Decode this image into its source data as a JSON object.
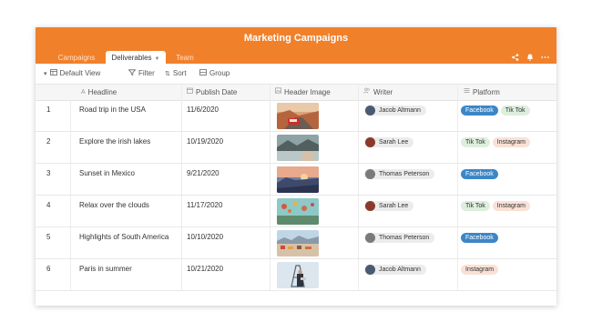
{
  "app": {
    "title": "Marketing Campaigns"
  },
  "tabs": [
    {
      "label": "Campaigns",
      "active": false
    },
    {
      "label": "Deliverables",
      "active": true
    },
    {
      "label": "Team",
      "active": false
    }
  ],
  "top_icons": [
    "share-icon",
    "bell-icon",
    "more-icon"
  ],
  "toolbar": {
    "view_label": "Default View",
    "filter_label": "Filter",
    "sort_label": "Sort",
    "group_label": "Group"
  },
  "columns": [
    {
      "label": "Headline",
      "icon": "text-icon"
    },
    {
      "label": "Publish Date",
      "icon": "calendar-icon"
    },
    {
      "label": "Header Image",
      "icon": "image-icon"
    },
    {
      "label": "Writer",
      "icon": "people-icon"
    },
    {
      "label": "Platform",
      "icon": "list-icon"
    }
  ],
  "rows": [
    {
      "num": "1",
      "headline": "Road trip in the USA",
      "date": "11/6/2020",
      "image": "road-trip-image",
      "writer": "Jacob Altmann",
      "platforms": [
        "Facebook",
        "Tik Tok"
      ]
    },
    {
      "num": "2",
      "headline": "Explore the irish lakes",
      "date": "10/19/2020",
      "image": "irish-lakes-image",
      "writer": "Sarah Lee",
      "platforms": [
        "Tik Tok",
        "Instagram"
      ]
    },
    {
      "num": "3",
      "headline": "Sunset in Mexico",
      "date": "9/21/2020",
      "image": "sunset-mexico-image",
      "writer": "Thomas Peterson",
      "platforms": [
        "Facebook"
      ]
    },
    {
      "num": "4",
      "headline": "Relax over the clouds",
      "date": "11/17/2020",
      "image": "clouds-balloons-image",
      "writer": "Sarah Lee",
      "platforms": [
        "Tik Tok",
        "Instagram"
      ]
    },
    {
      "num": "5",
      "headline": "Highlights of South America",
      "date": "10/10/2020",
      "image": "south-america-image",
      "writer": "Thomas Peterson",
      "platforms": [
        "Facebook"
      ]
    },
    {
      "num": "6",
      "headline": "Paris in summer",
      "date": "10/21/2020",
      "image": "paris-image",
      "writer": "Jacob Altmann",
      "platforms": [
        "Instagram"
      ]
    }
  ],
  "colors": {
    "accent": "#f1802a",
    "facebook": "#3d86c6",
    "tiktok": "#dcefdc",
    "instagram": "#f9e1d6"
  }
}
